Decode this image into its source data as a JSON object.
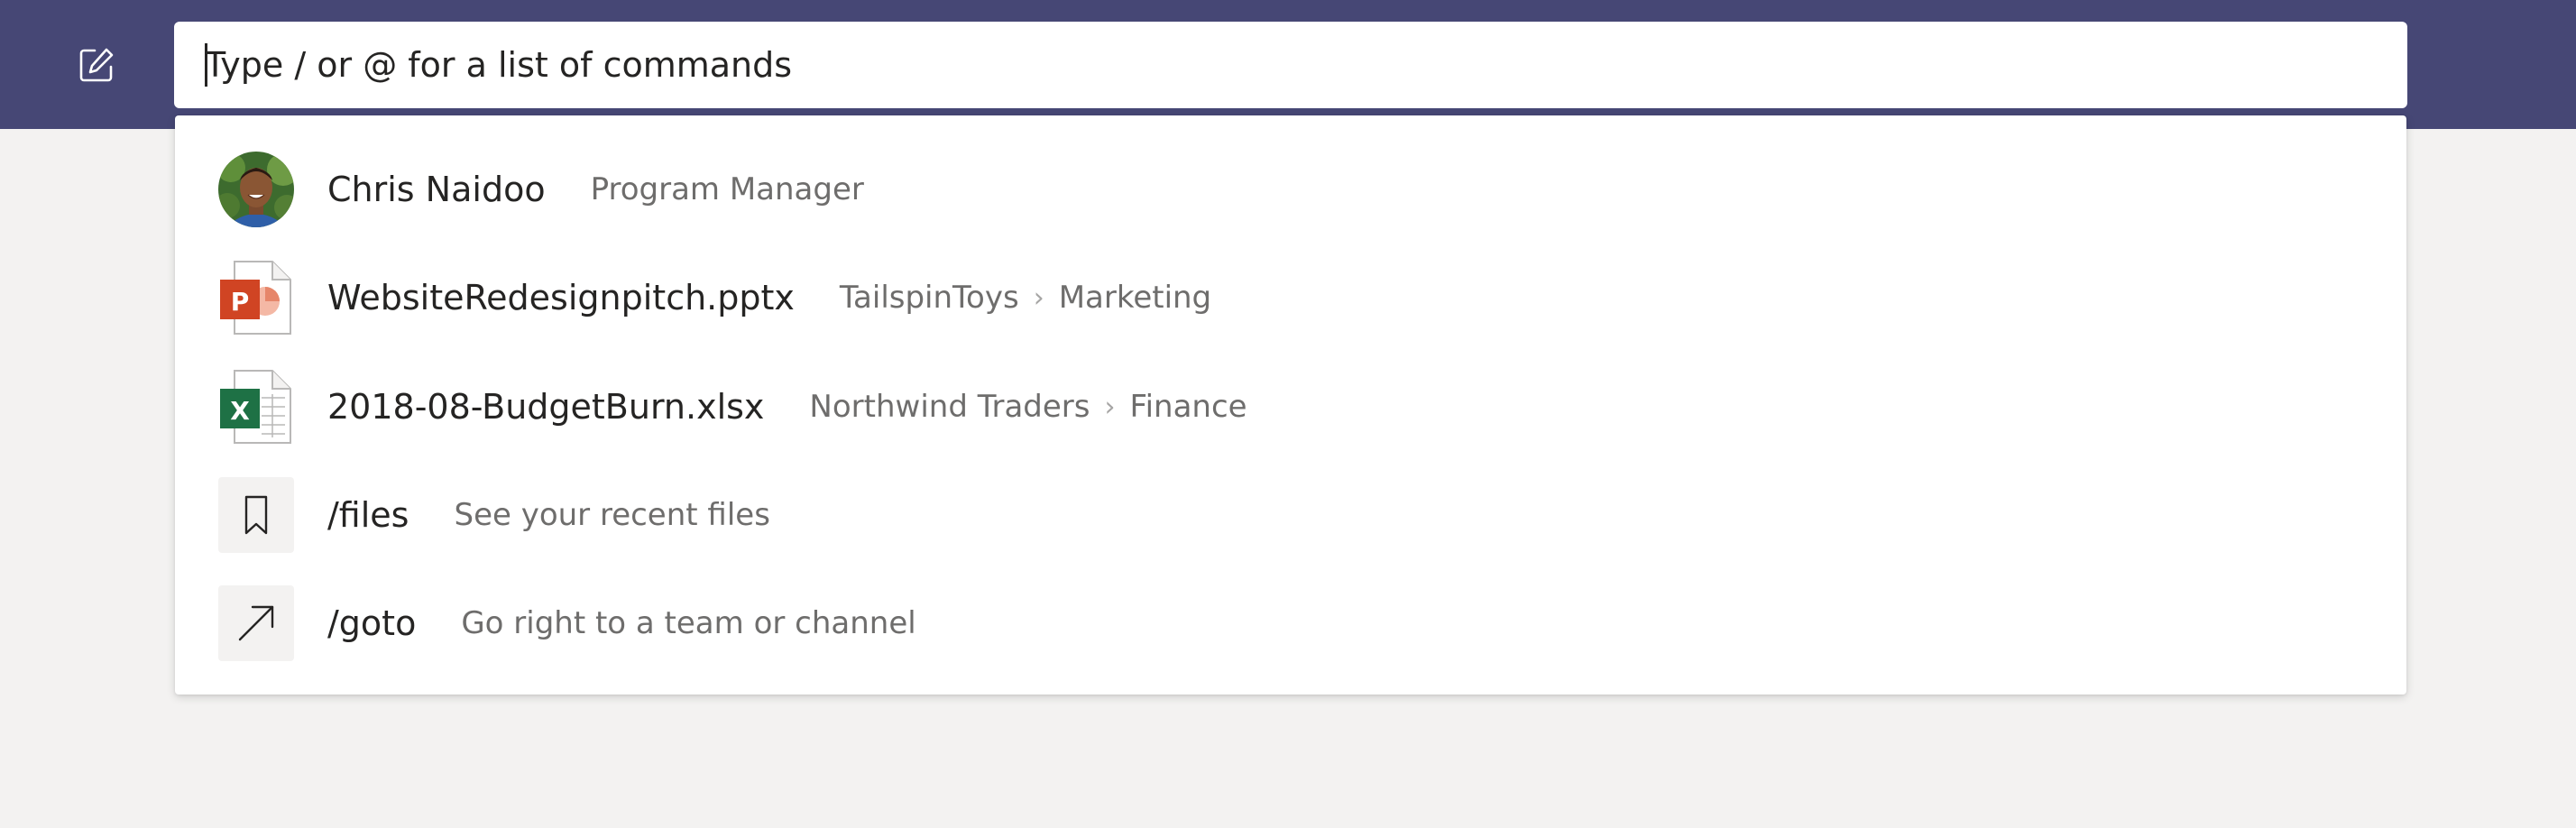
{
  "search": {
    "placeholder": "Type / or @ for a list of commands",
    "value": ""
  },
  "icons": {
    "compose": "compose-icon",
    "files": "bookmark-icon",
    "goto": "arrow-up-right-icon",
    "pptx": "powerpoint-file-icon",
    "xlsx": "excel-file-icon"
  },
  "colors": {
    "topbar": "#464775",
    "background": "#f3f2f1",
    "powerpoint": "#d04423",
    "excel": "#1e7145"
  },
  "suggestions": [
    {
      "type": "person",
      "name": "Chris Naidoo",
      "detail": "Program Manager"
    },
    {
      "type": "file",
      "name": "WebsiteRedesignpitch.pptx",
      "team": "TailspinToys",
      "channel": "Marketing"
    },
    {
      "type": "file",
      "name": "2018-08-BudgetBurn.xlsx",
      "team": "Northwind Traders",
      "channel": "Finance"
    },
    {
      "type": "command",
      "name": "/files",
      "detail": "See your recent files"
    },
    {
      "type": "command",
      "name": "/goto",
      "detail": "Go right to a team or channel"
    }
  ]
}
